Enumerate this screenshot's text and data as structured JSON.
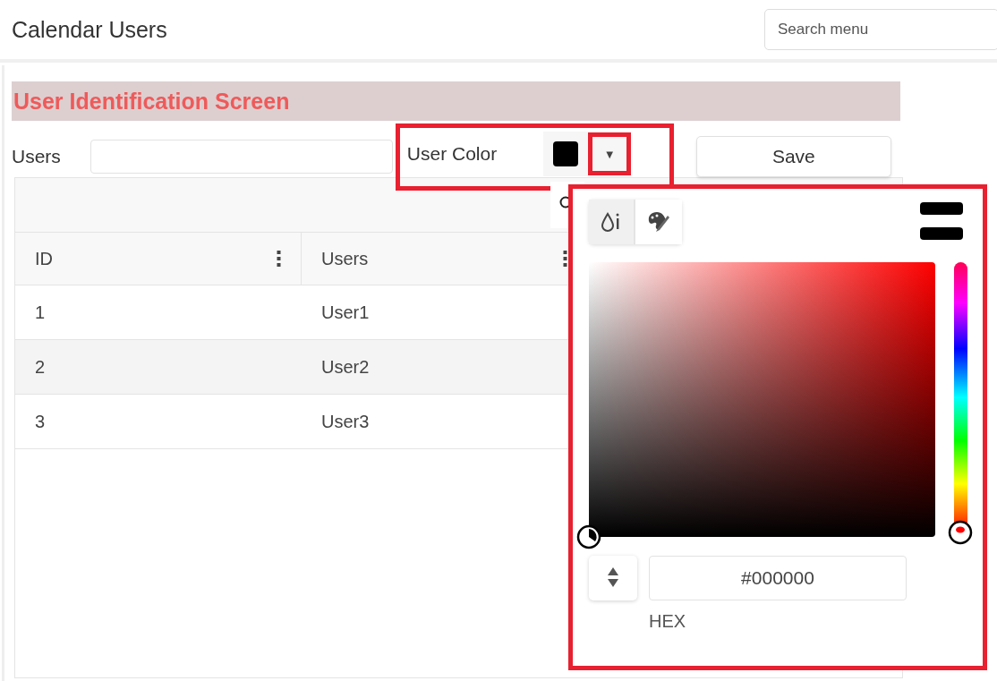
{
  "header": {
    "title": "Calendar Users",
    "search": {
      "placeholder": "Search menu"
    }
  },
  "form": {
    "heading": "User Identification Screen",
    "users_label": "Users",
    "color_label": "User Color",
    "dropdown_glyph": "▼",
    "dropdown_open": true,
    "save_label": "Save"
  },
  "grid": {
    "columns": [
      {
        "label": "ID"
      },
      {
        "label": "Users"
      }
    ],
    "rows": [
      {
        "cells": [
          "1",
          "User1"
        ]
      },
      {
        "cells": [
          "2",
          "User2"
        ]
      },
      {
        "cells": [
          "3",
          "User3"
        ]
      }
    ]
  },
  "picker": {
    "modes": [
      {
        "kind": "gradient",
        "selected": true
      },
      {
        "kind": "palette",
        "selected": false
      }
    ],
    "hue": {
      "level": 0
    },
    "value": "#000000",
    "format": "HEX"
  }
}
